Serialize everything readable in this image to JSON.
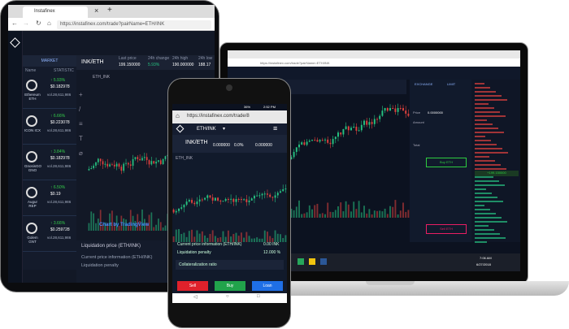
{
  "tablet": {
    "tab_title": "Instafinex",
    "url": "https://instafinex.com/trade?pairName=ETH/INK",
    "market_header": "MARKET",
    "list_head_name": "Name",
    "list_head_stats": "STATISTIC",
    "coins": [
      {
        "name": "Ethereum",
        "code": "ETH",
        "change": "5.93%",
        "price": "$0.182978",
        "vol": "vol.28,611,986"
      },
      {
        "name": "ICON",
        "code": "ICX",
        "change": "6.66%",
        "price": "$0.223078",
        "vol": "vol.28,611,986"
      },
      {
        "name": "GnosisGO",
        "code": "GNO",
        "change": "3.84%",
        "price": "$0.182978",
        "vol": "vol.28,611,986"
      },
      {
        "name": "Augur",
        "code": "REP",
        "change": "6.50%",
        "price": "$0.19",
        "vol": "vol.28,611,986"
      },
      {
        "name": "Golem",
        "code": "GNT",
        "change": "3.66%",
        "price": "$0.259728",
        "vol": "vol.28,611,986"
      }
    ],
    "pair": "INK/ETH",
    "last_price_label": "Last price",
    "last_price": "199.150000",
    "change_label": "24h change",
    "change_value": "5.93%",
    "high_label": "24h high",
    "high_value": "190.000000",
    "low_label": "24h low",
    "low_value": "188.17",
    "chart_pair": "ETH_INK",
    "tv_label": "Chart by TradingView",
    "liq_price": "Liquidation price (ETH/INK)",
    "current_info": "Current price information (ETH/INK)",
    "liq_penalty": "Liquidation penalty"
  },
  "laptop": {
    "url": "https://instafinex.com/trade?pairName=ETH/INK",
    "exchange_tab": "EXCHANGE",
    "limit_tab": "LIMIT",
    "buy_label": "Buy ETH",
    "sell_label": "Sell ETH",
    "price_label": "Price",
    "amount_label": "Amount",
    "total_label": "Total",
    "price_value": "0.0000000",
    "highlight_price": "0.95 CHANGE",
    "orderbook_mid": "+199.150000",
    "clock": "7:06 AM",
    "date": "6/27/2018"
  },
  "phone": {
    "time": "2:52 PM",
    "battery": "36%",
    "url": "https://instafinex.com/trade/8",
    "pair_menu": "ETH/INK",
    "pair": "INK/ETH",
    "last_price": "0.000000",
    "change_value": "0.0%",
    "high_value": "0.000000",
    "chart_pair": "ETH_INK",
    "current_info": "Current price information (ETH/INK)",
    "current_value": "0.00 INK",
    "liq_penalty": "Liquidation penalty",
    "liq_value": "12.000 %",
    "collateral": "Collateralization ratio",
    "sell": "Sell",
    "buy": "Buy",
    "loan": "Loan"
  },
  "colors": {
    "up": "#26c281",
    "down": "#e0413e",
    "sell_btn": "#e0212b",
    "buy_btn": "#21a34b",
    "loan_btn": "#1f6fe6"
  }
}
